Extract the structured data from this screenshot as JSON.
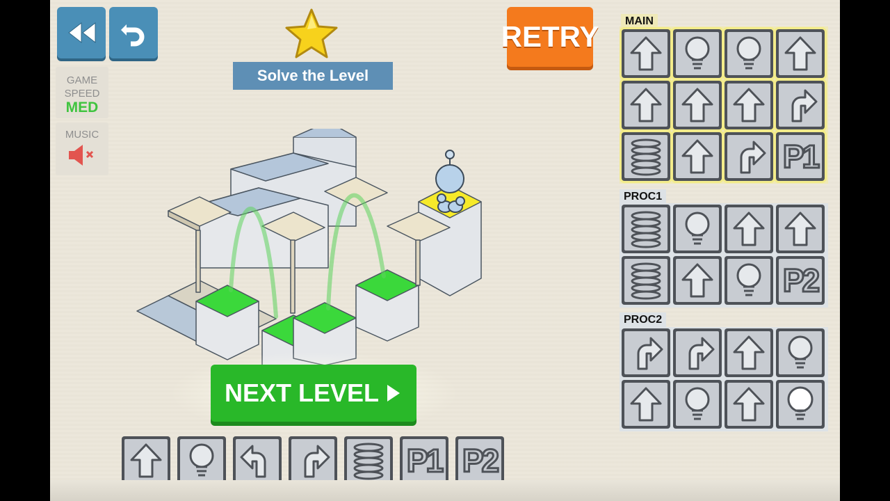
{
  "title": "Solve the Level",
  "retry_label": "RETRY",
  "next_level_label": "NEXT LEVEL",
  "game_speed": {
    "label_line1": "GAME",
    "label_line2": "SPEED",
    "value": "MED"
  },
  "music": {
    "label": "MUSIC",
    "state": "muted"
  },
  "main_label": "MAIN",
  "proc1_label": "PROC1",
  "proc2_label": "PROC2",
  "main_commands": [
    "forward",
    "light",
    "light",
    "forward",
    "forward",
    "forward",
    "forward",
    "turn-right",
    "jump",
    "forward",
    "turn-right",
    "P1"
  ],
  "proc1_commands": [
    "jump",
    "light",
    "forward",
    "forward",
    "jump",
    "forward",
    "light",
    "P2"
  ],
  "proc2_commands": [
    "turn-right",
    "turn-right",
    "forward",
    "light",
    "forward",
    "light",
    "forward",
    "light-active"
  ],
  "palette": [
    "forward",
    "light",
    "turn-left",
    "turn-right",
    "jump",
    "P1",
    "P2"
  ],
  "colors": {
    "accent_orange": "#f47a1d",
    "next_green": "#29b829",
    "button_blue": "#4a8fb7",
    "speed_green": "#3fc43f",
    "music_red": "#e2554f",
    "lit_tile": "#3bd83b",
    "robot_tile": "#f6ea2a"
  }
}
